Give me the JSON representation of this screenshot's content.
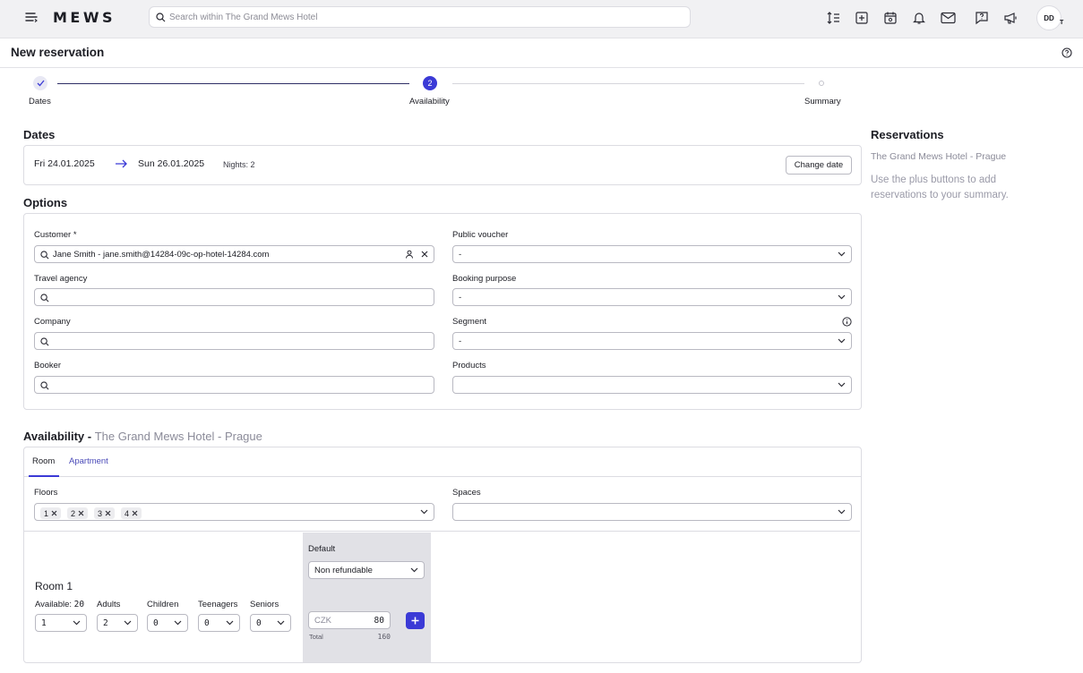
{
  "app": {
    "logo": "MEWS"
  },
  "search": {
    "placeholder": "Search within The Grand Mews Hotel"
  },
  "user": {
    "initials": "DD",
    "sub": "T"
  },
  "page": {
    "title": "New reservation"
  },
  "stepper": {
    "steps": [
      {
        "label": "Dates",
        "state": "done"
      },
      {
        "label": "Availability",
        "state": "active",
        "number": "2"
      },
      {
        "label": "Summary",
        "state": "pending"
      }
    ]
  },
  "dates": {
    "title": "Dates",
    "from": "Fri 24.01.2025",
    "to": "Sun 26.01.2025",
    "nights": "Nights: 2",
    "change_button": "Change date"
  },
  "options": {
    "title": "Options",
    "customer": {
      "label": "Customer *",
      "value": "Jane Smith - jane.smith@14284-09c-op-hotel-14284.com"
    },
    "travel_agency": {
      "label": "Travel agency",
      "value": ""
    },
    "company": {
      "label": "Company",
      "value": ""
    },
    "booker": {
      "label": "Booker",
      "value": ""
    },
    "public_voucher": {
      "label": "Public voucher",
      "value": "-"
    },
    "booking_purpose": {
      "label": "Booking purpose",
      "value": "-"
    },
    "segment": {
      "label": "Segment",
      "value": "-"
    },
    "products": {
      "label": "Products",
      "value": ""
    }
  },
  "reservations": {
    "title": "Reservations",
    "hotel": "The Grand Mews Hotel - Prague",
    "hint": "Use the plus buttons to add reservations to your summary."
  },
  "availability": {
    "title": "Availability -",
    "hotel": "The Grand Mews Hotel - Prague",
    "tabs": [
      {
        "label": "Room",
        "active": true
      },
      {
        "label": "Apartment",
        "active": false
      }
    ],
    "floors_label": "Floors",
    "floors": [
      "1",
      "2",
      "3",
      "4"
    ],
    "spaces_label": "Spaces",
    "spaces_value": ""
  },
  "room": {
    "name": "Room 1",
    "available_label": "Available:",
    "available_count": "20",
    "count_value": "1",
    "adults_label": "Adults",
    "adults_value": "2",
    "children_label": "Children",
    "children_value": "0",
    "teenagers_label": "Teenagers",
    "teenagers_value": "0",
    "seniors_label": "Seniors",
    "seniors_value": "0",
    "rate_label": "Default",
    "rate_value": "Non refundable",
    "currency": "CZK",
    "price": "80",
    "total_label": "Total",
    "total_value": "160"
  },
  "colors": {
    "accent": "#3b3ad6",
    "stepper_line": "#2e2e66",
    "panel": "#e1e1e6"
  }
}
